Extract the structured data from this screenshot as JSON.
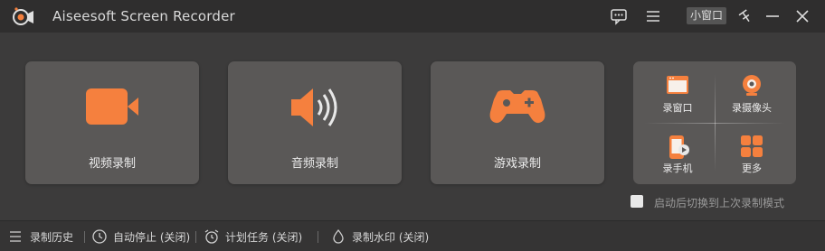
{
  "app": {
    "title": "Aiseesoft Screen Recorder",
    "accent_color": "#f5803e"
  },
  "titlebar": {
    "mini_window_label": "小窗口",
    "icons": [
      "chat-icon",
      "menu-icon",
      "pin-icon",
      "minimize-icon",
      "close-icon"
    ]
  },
  "cards": {
    "video": {
      "label": "视频录制",
      "icon": "video-camera-icon"
    },
    "audio": {
      "label": "音频录制",
      "icon": "speaker-icon"
    },
    "game": {
      "label": "游戏录制",
      "icon": "gamepad-icon"
    }
  },
  "multi": {
    "window": {
      "label": "录窗口",
      "icon": "window-icon"
    },
    "webcam": {
      "label": "录摄像头",
      "icon": "webcam-icon"
    },
    "phone": {
      "label": "录手机",
      "icon": "phone-icon"
    },
    "more": {
      "label": "更多",
      "icon": "grid-icon"
    }
  },
  "remember": {
    "label": "启动后切换到上次录制模式",
    "checked": false
  },
  "bottombar": {
    "history": {
      "label": "录制历史",
      "icon": "list-icon"
    },
    "auto_stop": {
      "label": "自动停止 (关闭)",
      "icon": "clock-icon"
    },
    "schedule": {
      "label": "计划任务 (关闭)",
      "icon": "alarm-clock-icon"
    },
    "watermark": {
      "label": "录制水印 (关闭)",
      "icon": "water-drop-icon"
    }
  }
}
